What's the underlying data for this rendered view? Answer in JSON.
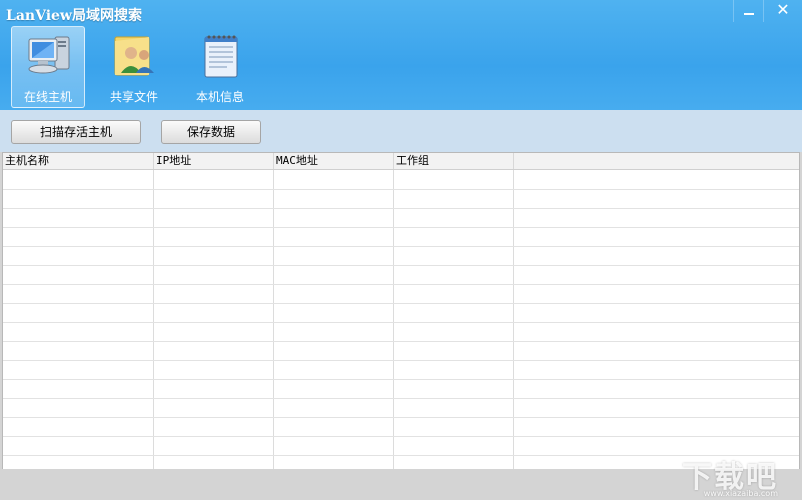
{
  "window": {
    "title": "LanView局域网搜索"
  },
  "nav": {
    "items": [
      {
        "label": "在线主机",
        "icon": "computer-icon",
        "active": true
      },
      {
        "label": "共享文件",
        "icon": "users-folder-icon",
        "active": false
      },
      {
        "label": "本机信息",
        "icon": "notepad-icon",
        "active": false
      }
    ]
  },
  "toolbar": {
    "scan_label": "扫描存活主机",
    "save_label": "保存数据"
  },
  "table": {
    "columns": [
      "主机名称",
      "IP地址",
      "MAC地址",
      "工作组",
      ""
    ],
    "rows": []
  },
  "watermark": {
    "text": "下载吧",
    "url": "www.xiazaiba.com"
  },
  "colors": {
    "titlebar": "#3aa3ec",
    "toolbar": "#ccdff0"
  }
}
